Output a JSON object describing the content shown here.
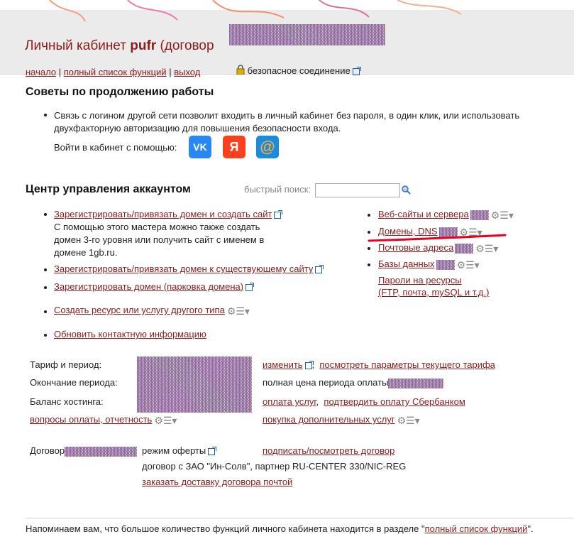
{
  "header": {
    "title_prefix": "Личный кабинет",
    "login": "pufr",
    "contract_prefix": "(договор",
    "nav": {
      "start": "начало",
      "full_list": "полный список функций",
      "exit": "выход",
      "sep": "|"
    },
    "secure": "безопасное соединение"
  },
  "tips": {
    "heading": "Советы по продолжению работы",
    "text": "Связь с логином другой сети позволит входить в личный кабинет без пароля, в один клик, или использовать двухфакторную авторизацию для повышения безопасности входа.",
    "login_with": "Войти в кабинет с помощью:",
    "socials": [
      {
        "label": "VK",
        "color": "#2787f5"
      },
      {
        "label": "Я",
        "color": "#fc3f1d"
      },
      {
        "label": "@",
        "color": "#168de2"
      }
    ]
  },
  "account": {
    "heading": "Центр управления аккаунтом",
    "quick_search": "быстрый поиск:",
    "left": {
      "item1_link": "Зарегистрировать/привязать домен и создать сайт",
      "item1_desc": "С помощью этого мастера можно также создать домен 3-го уровня или получить сайт с именем в домене 1gb.ru.",
      "item2_link": "Зарегистрировать/привязать домен к существующему сайту",
      "item3_link": "Зарегистрировать домен (парковка домена)",
      "item4_link": "Создать ресурс или услугу другого типа",
      "item5_link": "Обновить контактную информацию"
    },
    "right": {
      "websites": "Веб-сайты и сервера",
      "domains": "Домены, DNS",
      "mail": "Почтовые адреса",
      "db": "Базы данных",
      "passwords": "Пароли на ресурсы",
      "passwords_sub": "(FTP, почта, mySQL и т.д.)"
    }
  },
  "tariff": {
    "tariff_label": "Тариф и период:",
    "end_label": "Окончание периода:",
    "balance_label": "Баланс хостинга:",
    "payment_questions": "вопросы оплаты, отчетность",
    "change": "изменить",
    "comma": ",",
    "params": "посмотреть параметры текущего тарифа",
    "full_price": "полная цена периода оплаты",
    "pay": "оплата услуг",
    "sber": "подтвердить оплату Сбербанком",
    "extra": "покупка дополнительных услуг"
  },
  "contract": {
    "label": "Договор",
    "offer": "режим оферты",
    "sign": "подписать/посмотреть договор",
    "with": "договор с ЗАО \"Ин-Солв\", партнер RU-CENTER 330/NIC-REG",
    "delivery": "заказать доставку договора почтой"
  },
  "footer": {
    "text_before": "Напоминаем вам, что большое количество функций личного кабинета находится в разделе \"",
    "link": "полный список функций",
    "text_after": "\"."
  },
  "colors": {
    "link": "#8a1c1c",
    "header_bg": "#ebebeb",
    "annotation": "#e8001c"
  }
}
